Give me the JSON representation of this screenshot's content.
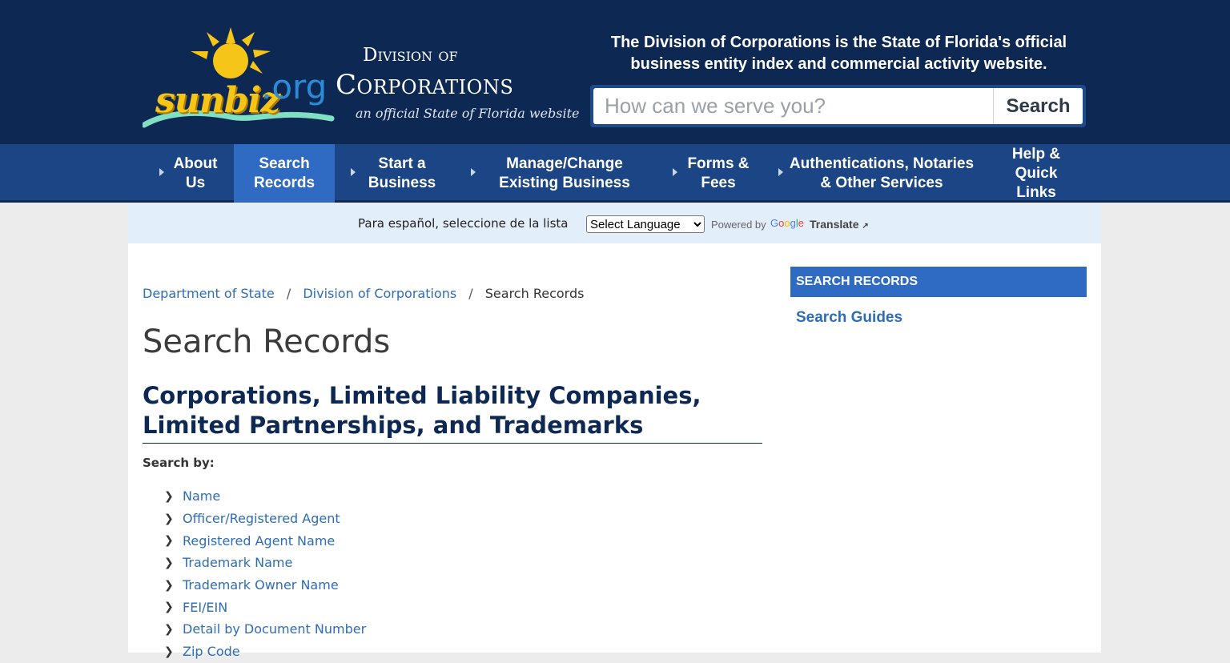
{
  "header": {
    "logo": {
      "sunbiz": "sunbiz",
      "org": ".org",
      "division": "Division of",
      "corporations": "Corporations",
      "official": "an official State of Florida website"
    },
    "tagline": "The Division of Corporations is the State of Florida's official business entity index and commercial activity website.",
    "search": {
      "placeholder": "How can we serve you?",
      "value": "",
      "button_label": "Search"
    }
  },
  "nav": {
    "items": [
      {
        "label": "About Us"
      },
      {
        "label": "Search Records",
        "active": true
      },
      {
        "label": "Start a Business"
      },
      {
        "label": "Manage/Change Existing Business"
      },
      {
        "label": "Forms & Fees"
      },
      {
        "label": "Authentications, Notaries & Other Services"
      },
      {
        "label": "Help & Quick Links"
      }
    ]
  },
  "translate": {
    "label": "Para español, seleccione de la lista",
    "select_value": "Select Language",
    "powered_by": "Powered by",
    "google": "Google",
    "translate_link": "Translate"
  },
  "breadcrumb": {
    "items": [
      "Department of State",
      "Division of Corporations",
      "Search Records"
    ],
    "separator": "/"
  },
  "main": {
    "title": "Search Records",
    "subheading": "Corporations, Limited Liability Companies, Limited Partnerships, and Trademarks",
    "search_by_label": "Search by:",
    "links": [
      "Name",
      "Officer/Registered Agent",
      "Registered Agent Name",
      "Trademark Name",
      "Trademark Owner Name",
      "FEI/EIN",
      "Detail by Document Number",
      "Zip Code"
    ]
  },
  "sidebar": {
    "heading": "SEARCH RECORDS",
    "links": [
      "Search Guides"
    ]
  },
  "colors": {
    "header_bg": "#0d2853",
    "nav_bg": "#1b4584",
    "accent": "#2f6bc3",
    "link": "#2e6db4"
  }
}
